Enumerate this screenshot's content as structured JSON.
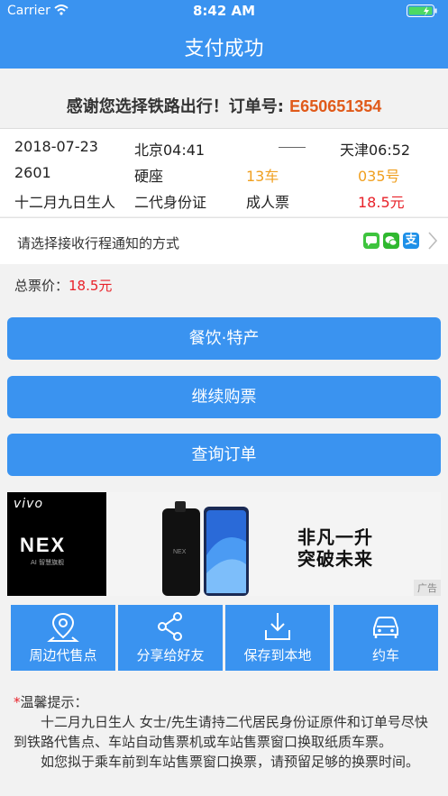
{
  "status": {
    "carrier": "Carrier",
    "time": "8:42 AM"
  },
  "header": {
    "title": "支付成功"
  },
  "thanks": {
    "text": "感谢您选择铁路出行！订单号: ",
    "order_no": "E650651354"
  },
  "ticket": {
    "date": "2018-07-23",
    "from": "北京04:41",
    "to": "天津06:52",
    "train_no": "2601",
    "seat_class": "硬座",
    "car": "13车",
    "seat_no": "035号",
    "passenger": "十二月九日生人",
    "id_type": "二代身份证",
    "ticket_type": "成人票",
    "price": "18.5元"
  },
  "notify": {
    "label": "请选择接收行程通知的方式",
    "icons": [
      "sms-icon",
      "wechat-icon",
      "alipay-icon"
    ],
    "alipay_glyph": "支"
  },
  "total": {
    "label": "总票价：",
    "value": "18.5元"
  },
  "buttons": {
    "food": "餐饮·特产",
    "continue": "继续购票",
    "query": "查询订单"
  },
  "ad": {
    "brand": "vivo",
    "product": "NEX",
    "product_sub": "AI 智慧旗舰",
    "slogan_1": "非凡一升",
    "slogan_2": "突破未来",
    "badge": "广告"
  },
  "tiles": [
    {
      "label": "周边代售点",
      "icon": "location-pin-icon"
    },
    {
      "label": "分享给好友",
      "icon": "share-icon"
    },
    {
      "label": "保存到本地",
      "icon": "download-icon"
    },
    {
      "label": "约车",
      "icon": "car-icon"
    }
  ],
  "tips": {
    "star": "*",
    "title": "温馨提示：",
    "p1": "十二月九日生人 女士/先生请持二代居民身份证原件和订单号尽快到铁路代售点、车站自动售票机或车站售票窗口换取纸质车票。",
    "p2": "如您拟于乘车前到车站售票窗口换票，请预留足够的换票时间。"
  },
  "colors": {
    "primary": "#3a93f0",
    "order_no": "#e05a1a",
    "seat": "#f0a020",
    "price": "#e8222a"
  }
}
